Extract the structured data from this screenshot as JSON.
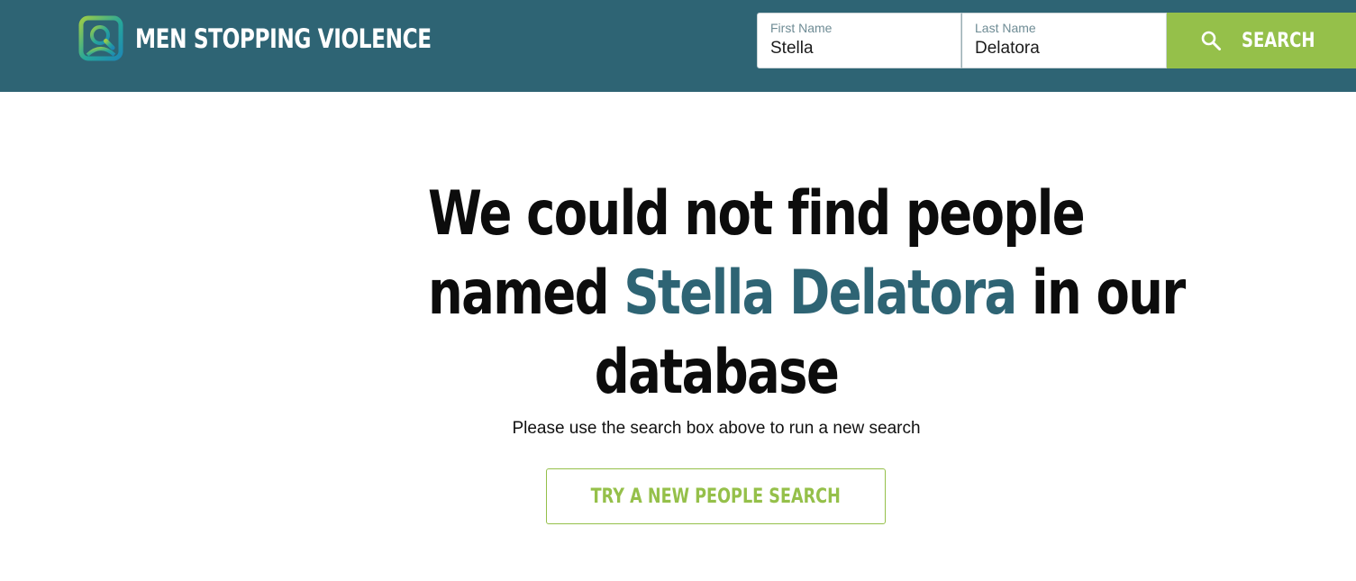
{
  "brand": {
    "name": "MEN STOPPING VIOLENCE",
    "logo_icon": "magnifier-in-square-icon"
  },
  "search": {
    "first_name_label": "First Name",
    "first_name_value": "Stella",
    "last_name_label": "Last Name",
    "last_name_value": "Delatora",
    "button_label": "SEARCH",
    "button_icon": "search-icon"
  },
  "results": {
    "headline_line1": "We could not find people",
    "headline_named": "named",
    "headline_name": "Stella Delatora",
    "headline_in_our": "in our",
    "headline_line3": "database",
    "subtext": "Please use the search box above to run a new search",
    "new_search_label": "TRY A NEW PEOPLE SEARCH"
  },
  "colors": {
    "header_bg": "#2e6474",
    "accent_green": "#95c04a",
    "name_highlight": "#2e6474"
  }
}
